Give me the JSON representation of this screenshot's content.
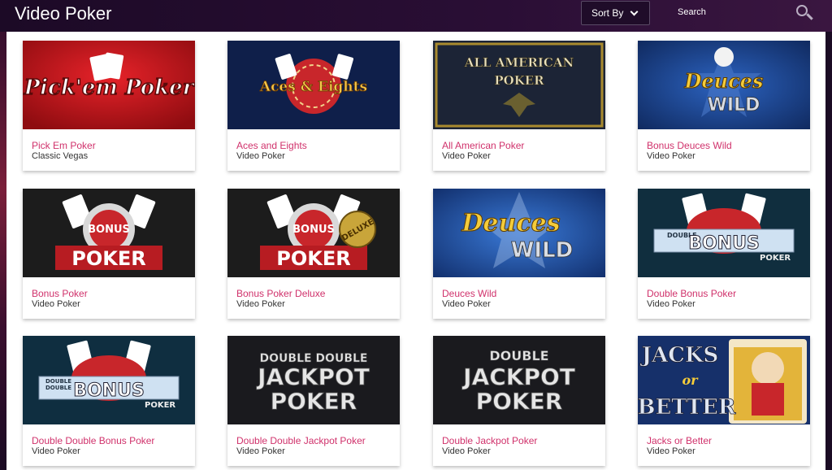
{
  "header": {
    "title": "Video Poker",
    "sort_label": "Sort By",
    "search_label": "Search"
  },
  "games": [
    {
      "title": "Pick Em Poker",
      "category": "Classic Vegas",
      "art": "Pick'em Poker"
    },
    {
      "title": "Aces and Eights",
      "category": "Video Poker",
      "art": "Aces & Eights"
    },
    {
      "title": "All American Poker",
      "category": "Video Poker",
      "art": "ALL AMERICAN POKER"
    },
    {
      "title": "Bonus Deuces Wild",
      "category": "Video Poker",
      "art": "Bonus Deuces Wild"
    },
    {
      "title": "Bonus Poker",
      "category": "Video Poker",
      "art": "BONUS POKER"
    },
    {
      "title": "Bonus Poker Deluxe",
      "category": "Video Poker",
      "art": "BONUS POKER DELUXE"
    },
    {
      "title": "Deuces Wild",
      "category": "Video Poker",
      "art": "Deuces WILD"
    },
    {
      "title": "Double Bonus Poker",
      "category": "Video Poker",
      "art": "DOUBLE BONUS POKER"
    },
    {
      "title": "Double Double Bonus Poker",
      "category": "Video Poker",
      "art": "DOUBLE DOUBLE BONUS POKER"
    },
    {
      "title": "Double Double Jackpot Poker",
      "category": "Video Poker",
      "art": "DOUBLE DOUBLE JACKPOT POKER"
    },
    {
      "title": "Double Jackpot Poker",
      "category": "Video Poker",
      "art": "DOUBLE JACKPOT POKER"
    },
    {
      "title": "Jacks or Better",
      "category": "Video Poker",
      "art": "JACKS or BETTER"
    }
  ],
  "colors": {
    "title_accent": "#d0316b",
    "header_bg": "#1c0a26"
  }
}
